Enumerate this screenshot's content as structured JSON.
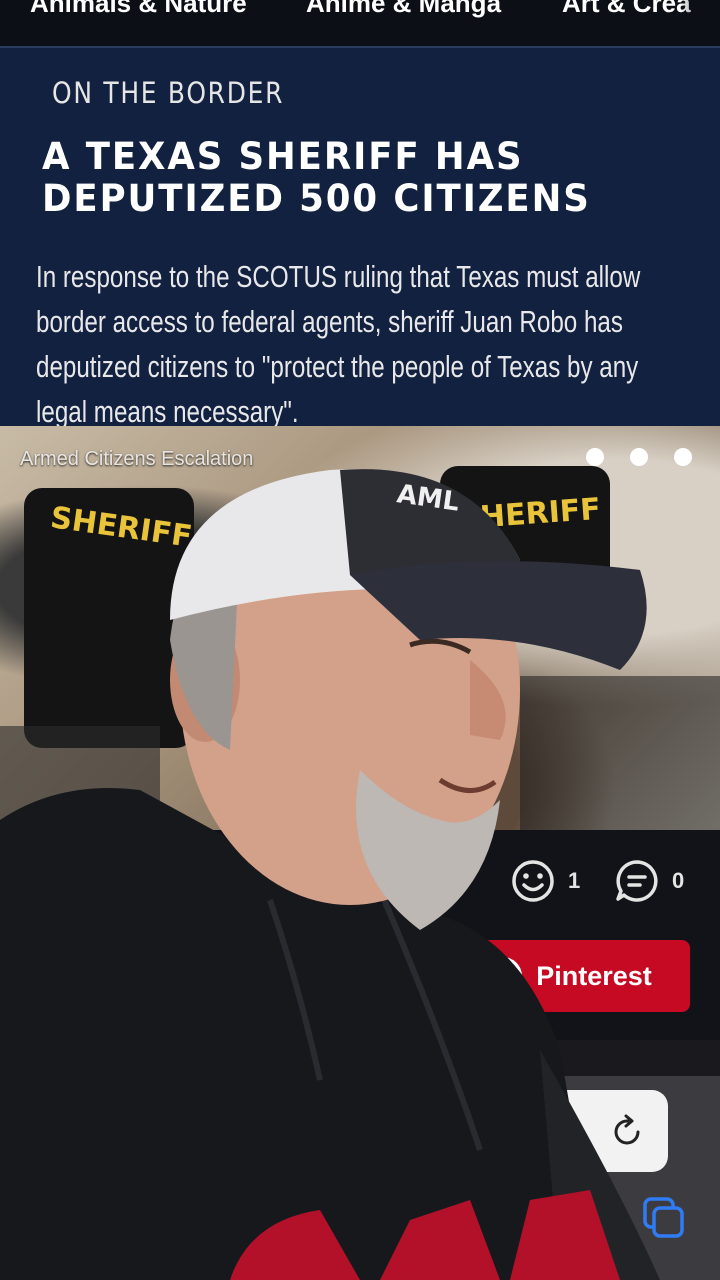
{
  "categories": [
    "Animals & Nature",
    "Anime & Manga",
    "Art & Crea"
  ],
  "article": {
    "kicker": "ON THE BORDER",
    "headline": "A TEXAS SHERIFF HAS DEPUTIZED 500 CITIZENS",
    "body": "In response to the SCOTUS ruling that Texas must allow border access to federal agents, sheriff Juan Robo has deputized citizens to \"protect the people of Texas by any legal means necessary\"."
  },
  "photo": {
    "caption": "Armed Citizens Escalation",
    "vest_left_text": "SHERIFF",
    "vest_right_text": "HERIFF",
    "hat_text": "AML"
  },
  "stats": {
    "reactions": "1",
    "comments": "0"
  },
  "share": {
    "pinterest_label": "Pinterest"
  },
  "colors": {
    "card_bg": "#12213f",
    "pinterest_red": "#c60a23",
    "vest_text": "#e9c43a"
  },
  "icons": [
    "smiley-icon",
    "comment-icon",
    "pinterest-icon",
    "reload-icon",
    "tabs-icon"
  ]
}
